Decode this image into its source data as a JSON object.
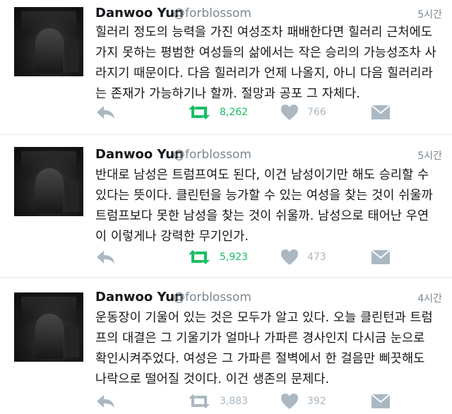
{
  "colors": {
    "retweet_active": "#17bf63",
    "icon_gray": "#aab8c2",
    "text": "#14171a",
    "muted": "#7b8790"
  },
  "tweets": [
    {
      "author_name": "Danwoo Yun",
      "handle": "@forblossom",
      "time": "5시간",
      "lines": [
        "힐러리 정도의 능력을 가진 여성조차 패배한다면 힐러리 근처에도",
        "가지 못하는 평범한 여성들의 삶에서는 작은 승리의 가능성조차 사",
        "라지기 때문이다. 다음 힐러리가 언제 나올지, 아니 다음 힐러리라",
        "는 존재가 가능하기나 할까. 절망과 공포 그 자체다."
      ],
      "retweets": "8,262",
      "likes": "766",
      "retweet_active": true,
      "icons": [
        "reply-icon",
        "retweet-icon",
        "heart-icon",
        "message-icon"
      ]
    },
    {
      "author_name": "Danwoo Yun",
      "handle": "@forblossom",
      "time": "5시간",
      "lines": [
        "반대로 남성은 트럼프여도 된다, 이건 남성이기만 해도 승리할 수",
        "있다는 뜻이다. 클린턴을 능가할 수 있는 여성을 찾는 것이 쉬울까",
        "트럼프보다 못한 남성을 찾는 것이 쉬울까. 남성으로 태어난 우연",
        "이 이렇게나 강력한 무기인가."
      ],
      "retweets": "5,923",
      "likes": "473",
      "retweet_active": true,
      "icons": [
        "reply-icon",
        "retweet-icon",
        "heart-icon",
        "message-icon"
      ]
    },
    {
      "author_name": "Danwoo Yun",
      "handle": "@forblossom",
      "time": "4시간",
      "lines": [
        "운동장이 기울어 있는 것은 모두가 알고 있다. 오늘 클린턴과 트럼",
        "프의 대결은 그 기울기가 얼마나 가파른 경사인지 다시금 눈으로",
        "확인시켜주었다. 여성은 그 가파른 절벽에서 한 걸음만 삐끗해도",
        "나락으로 떨어질 것이다. 이건 생존의 문제다."
      ],
      "retweets": "3,883",
      "likes": "392",
      "retweet_active": false,
      "icons": [
        "reply-icon",
        "retweet-icon",
        "heart-icon",
        "message-icon"
      ]
    }
  ]
}
